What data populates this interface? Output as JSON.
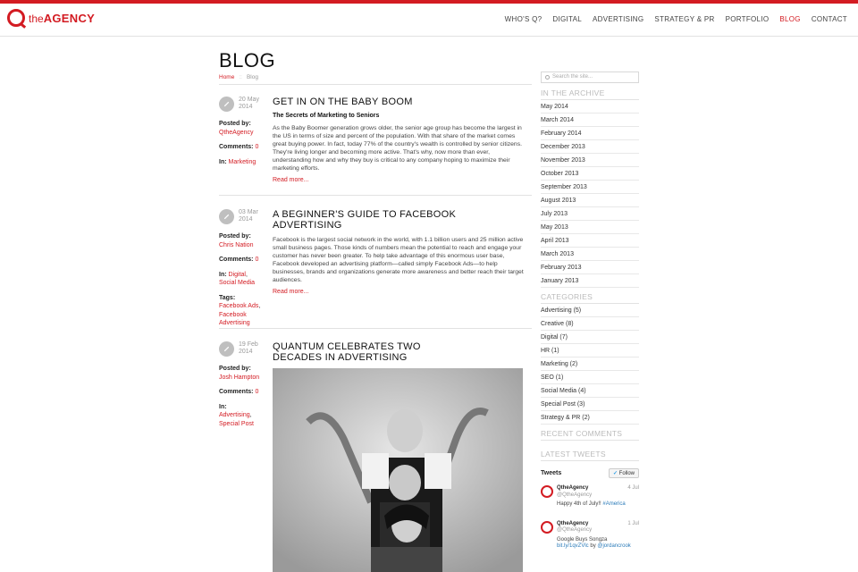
{
  "brand": {
    "name_the": "the",
    "name_agency": "AGENCY",
    "accent": "#d31b22"
  },
  "nav": [
    {
      "label": "WHO'S Q?",
      "active": false
    },
    {
      "label": "DIGITAL",
      "active": false
    },
    {
      "label": "ADVERTISING",
      "active": false
    },
    {
      "label": "STRATEGY & PR",
      "active": false
    },
    {
      "label": "PORTFOLIO",
      "active": false
    },
    {
      "label": "BLOG",
      "active": true
    },
    {
      "label": "CONTACT",
      "active": false
    }
  ],
  "page": {
    "title": "BLOG",
    "breadcrumb": {
      "home": "Home",
      "current": "Blog"
    }
  },
  "labels": {
    "posted_by": "Posted by:",
    "comments": "Comments:",
    "in": "In:",
    "tags": "Tags:",
    "read_more": "Read more..."
  },
  "posts": [
    {
      "date_day_month": "20 May",
      "date_year": "2014",
      "author": "QtheAgency",
      "comments": "0",
      "category": "Marketing",
      "title": "GET IN ON THE BABY BOOM",
      "subtitle": "The Secrets of Marketing to Seniors",
      "body": "As the Baby Boomer generation grows older, the senior age group has become the largest in the US in terms of size and percent of the population. With that share of the market comes great buying power. In fact, today 77% of the country's wealth is controlled by senior citizens. They're living longer and becoming more active. That's why, now more than ever, understanding how and why they buy is critical to any company hoping to maximize their marketing efforts."
    },
    {
      "date_day_month": "03 Mar",
      "date_year": "2014",
      "author": "Chris Nation",
      "comments": "0",
      "category_1": "Digital",
      "category_2": "Social Media",
      "tag_1": "Facebook Ads",
      "tag_2": "Facebook Advertising",
      "title": "A BEGINNER'S GUIDE TO FACEBOOK ADVERTISING",
      "body": "Facebook is the largest social network in the world, with 1.1 billion users and 25 million active small business pages. Those kinds of numbers mean the potential to reach and engage your customer has never been greater. To help take advantage of this enormous user base, Facebook developed an advertising platform—called simply Facebook Ads—to help businesses, brands and organizations generate more awareness and better reach their target audiences."
    },
    {
      "date_day_month": "19 Feb",
      "date_year": "2014",
      "author": "Josh Hampton",
      "comments": "0",
      "category_1": "Advertising",
      "category_2": "Special Post",
      "title": "QUANTUM CELEBRATES TWO DECADES IN ADVERTISING"
    }
  ],
  "sidebar": {
    "search_placeholder": "Search the site...",
    "archive_heading": "IN THE ARCHIVE",
    "archive": [
      "May 2014",
      "March 2014",
      "February 2014",
      "December 2013",
      "November 2013",
      "October 2013",
      "September 2013",
      "August 2013",
      "July 2013",
      "May 2013",
      "April 2013",
      "March 2013",
      "February 2013",
      "January 2013"
    ],
    "categories_heading": "CATEGORIES",
    "categories": [
      "Advertising (5)",
      "Creative (8)",
      "Digital (7)",
      "HR (1)",
      "Marketing (2)",
      "SEO (1)",
      "Social Media (4)",
      "Special Post (3)",
      "Strategy & PR (2)"
    ],
    "recent_comments_heading": "RECENT COMMENTS",
    "latest_tweets_heading": "LATEST TWEETS",
    "tweets_label": "Tweets",
    "follow_label": "Follow",
    "tweets": [
      {
        "name": "QtheAgency",
        "handle": "@QtheAgency",
        "date": "4 Jul",
        "text": "Happy 4th of July!! ",
        "link": "#America"
      },
      {
        "name": "QtheAgency",
        "handle": "@QtheAgency",
        "date": "1 Jul",
        "text": "Google Buys Songza ",
        "link": "bit.ly/1qvZVlc",
        "text2": " by ",
        "link2": "@jordancrook"
      }
    ]
  }
}
